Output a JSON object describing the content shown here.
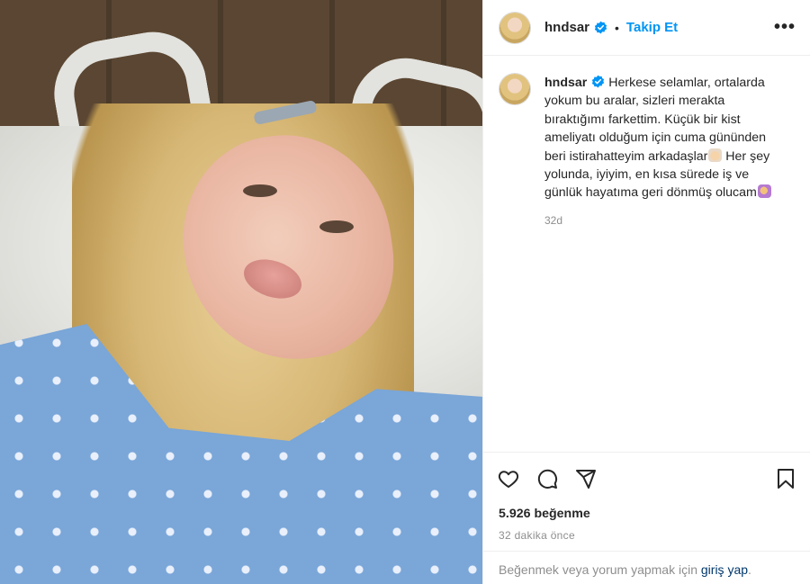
{
  "post": {
    "username": "hndsar",
    "verified_icon": "verified-badge-icon",
    "separator": "•",
    "follow_label": "Takip Et",
    "more_label": "•••",
    "caption_text": "Herkese selamlar, ortalarda yokum bu aralar, sizleri merakta bıraktığımı farkettim. Küçük bir kist ameliyatı olduğum için cuma gününden beri istirahatteyim arkadaşlar",
    "caption_text_2": " Her şey yolunda, iyiyim, en kısa sürede iş ve günlük hayatıma geri dönmüş olucam",
    "caption_time": "32d",
    "likes": "5.926 beğenme",
    "posted_ago": "32 dakika önce",
    "login_prompt": "Beğenmek veya yorum yapmak için",
    "login_link": "giriş yap",
    "login_suffix": "."
  },
  "icons": {
    "like": "heart-icon",
    "comment": "comment-icon",
    "share": "share-icon",
    "save": "bookmark-icon"
  },
  "colors": {
    "accent": "#0095f6",
    "verified": "#0095f6",
    "muted": "#8e8e8e",
    "link": "#00376b"
  }
}
